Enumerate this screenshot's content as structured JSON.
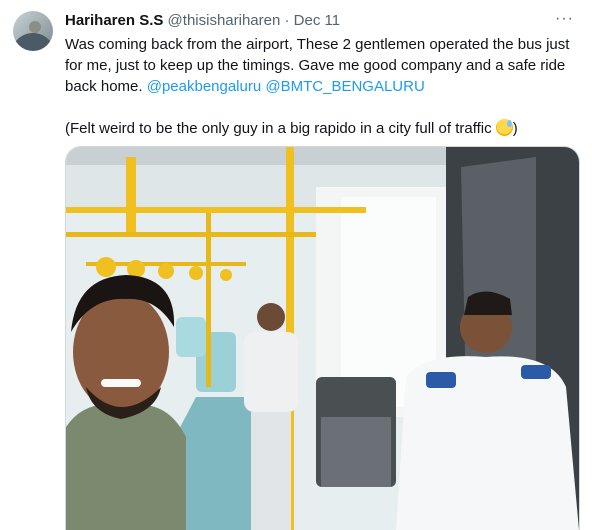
{
  "tweet": {
    "author_name": "Hariharen S.S",
    "author_handle": "@thisishariharen",
    "separator": "·",
    "date": "Dec 11",
    "more_label": "···",
    "text_line1": "Was coming back from the airport, These 2 gentlemen operated the bus just for me, just to keep up the timings. Gave me good company and a safe ride back home. ",
    "mention1": "@peakbengaluru",
    "mention2": "@BMTC_BENGALURU",
    "text_line2_prefix": "(Felt weird to be the only guy in a big rapido in a city full of traffic ",
    "text_line2_suffix": ")"
  },
  "icons": {
    "emoji": "sweat-smile-emoji",
    "more": "more-icon"
  },
  "colors": {
    "link": "#1d9bf0",
    "secondary": "#536471",
    "text": "#0f1419"
  }
}
